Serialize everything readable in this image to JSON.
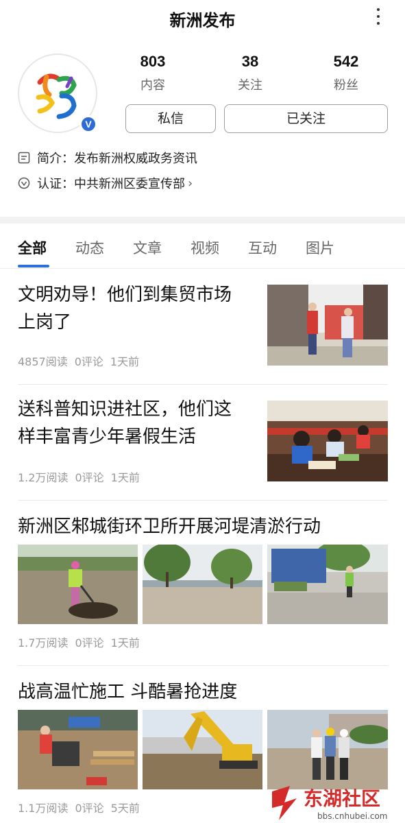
{
  "header": {
    "title": "新洲发布"
  },
  "profile": {
    "stats": [
      {
        "value": "803",
        "label": "内容"
      },
      {
        "value": "38",
        "label": "关注"
      },
      {
        "value": "542",
        "label": "粉丝"
      }
    ],
    "message_button": "私信",
    "follow_button": "已关注",
    "intro": "简介：发布新洲权威政务资讯",
    "verification": "认证：中共新洲区委宣传部"
  },
  "tabs": [
    "全部",
    "动态",
    "文章",
    "视频",
    "互动",
    "图片"
  ],
  "articles": [
    {
      "title_line1": "文明劝导！他们到集贸市场",
      "title_line2": "上岗了",
      "reads": "4857阅读",
      "comments": "0评论",
      "time": "1天前"
    },
    {
      "title_line1": "送科普知识进社区，他们这",
      "title_line2": "样丰富青少年暑假生活",
      "reads": "1.2万阅读",
      "comments": "0评论",
      "time": "1天前"
    },
    {
      "title": "新洲区邾城街环卫所开展河堤清淤行动",
      "reads": "1.7万阅读",
      "comments": "0评论",
      "time": "1天前"
    },
    {
      "title": "战高温忙施工 斗酷暑抢进度",
      "reads": "1.1万阅读",
      "comments": "0评论",
      "time": "5天前"
    }
  ],
  "watermark": {
    "brand": "东湖社区",
    "url": "bbs.cnhubei.com"
  },
  "colors": {
    "accent": "#2f6fd8",
    "verified": "#2d6bd8",
    "watermark_red": "#d42a2a"
  }
}
